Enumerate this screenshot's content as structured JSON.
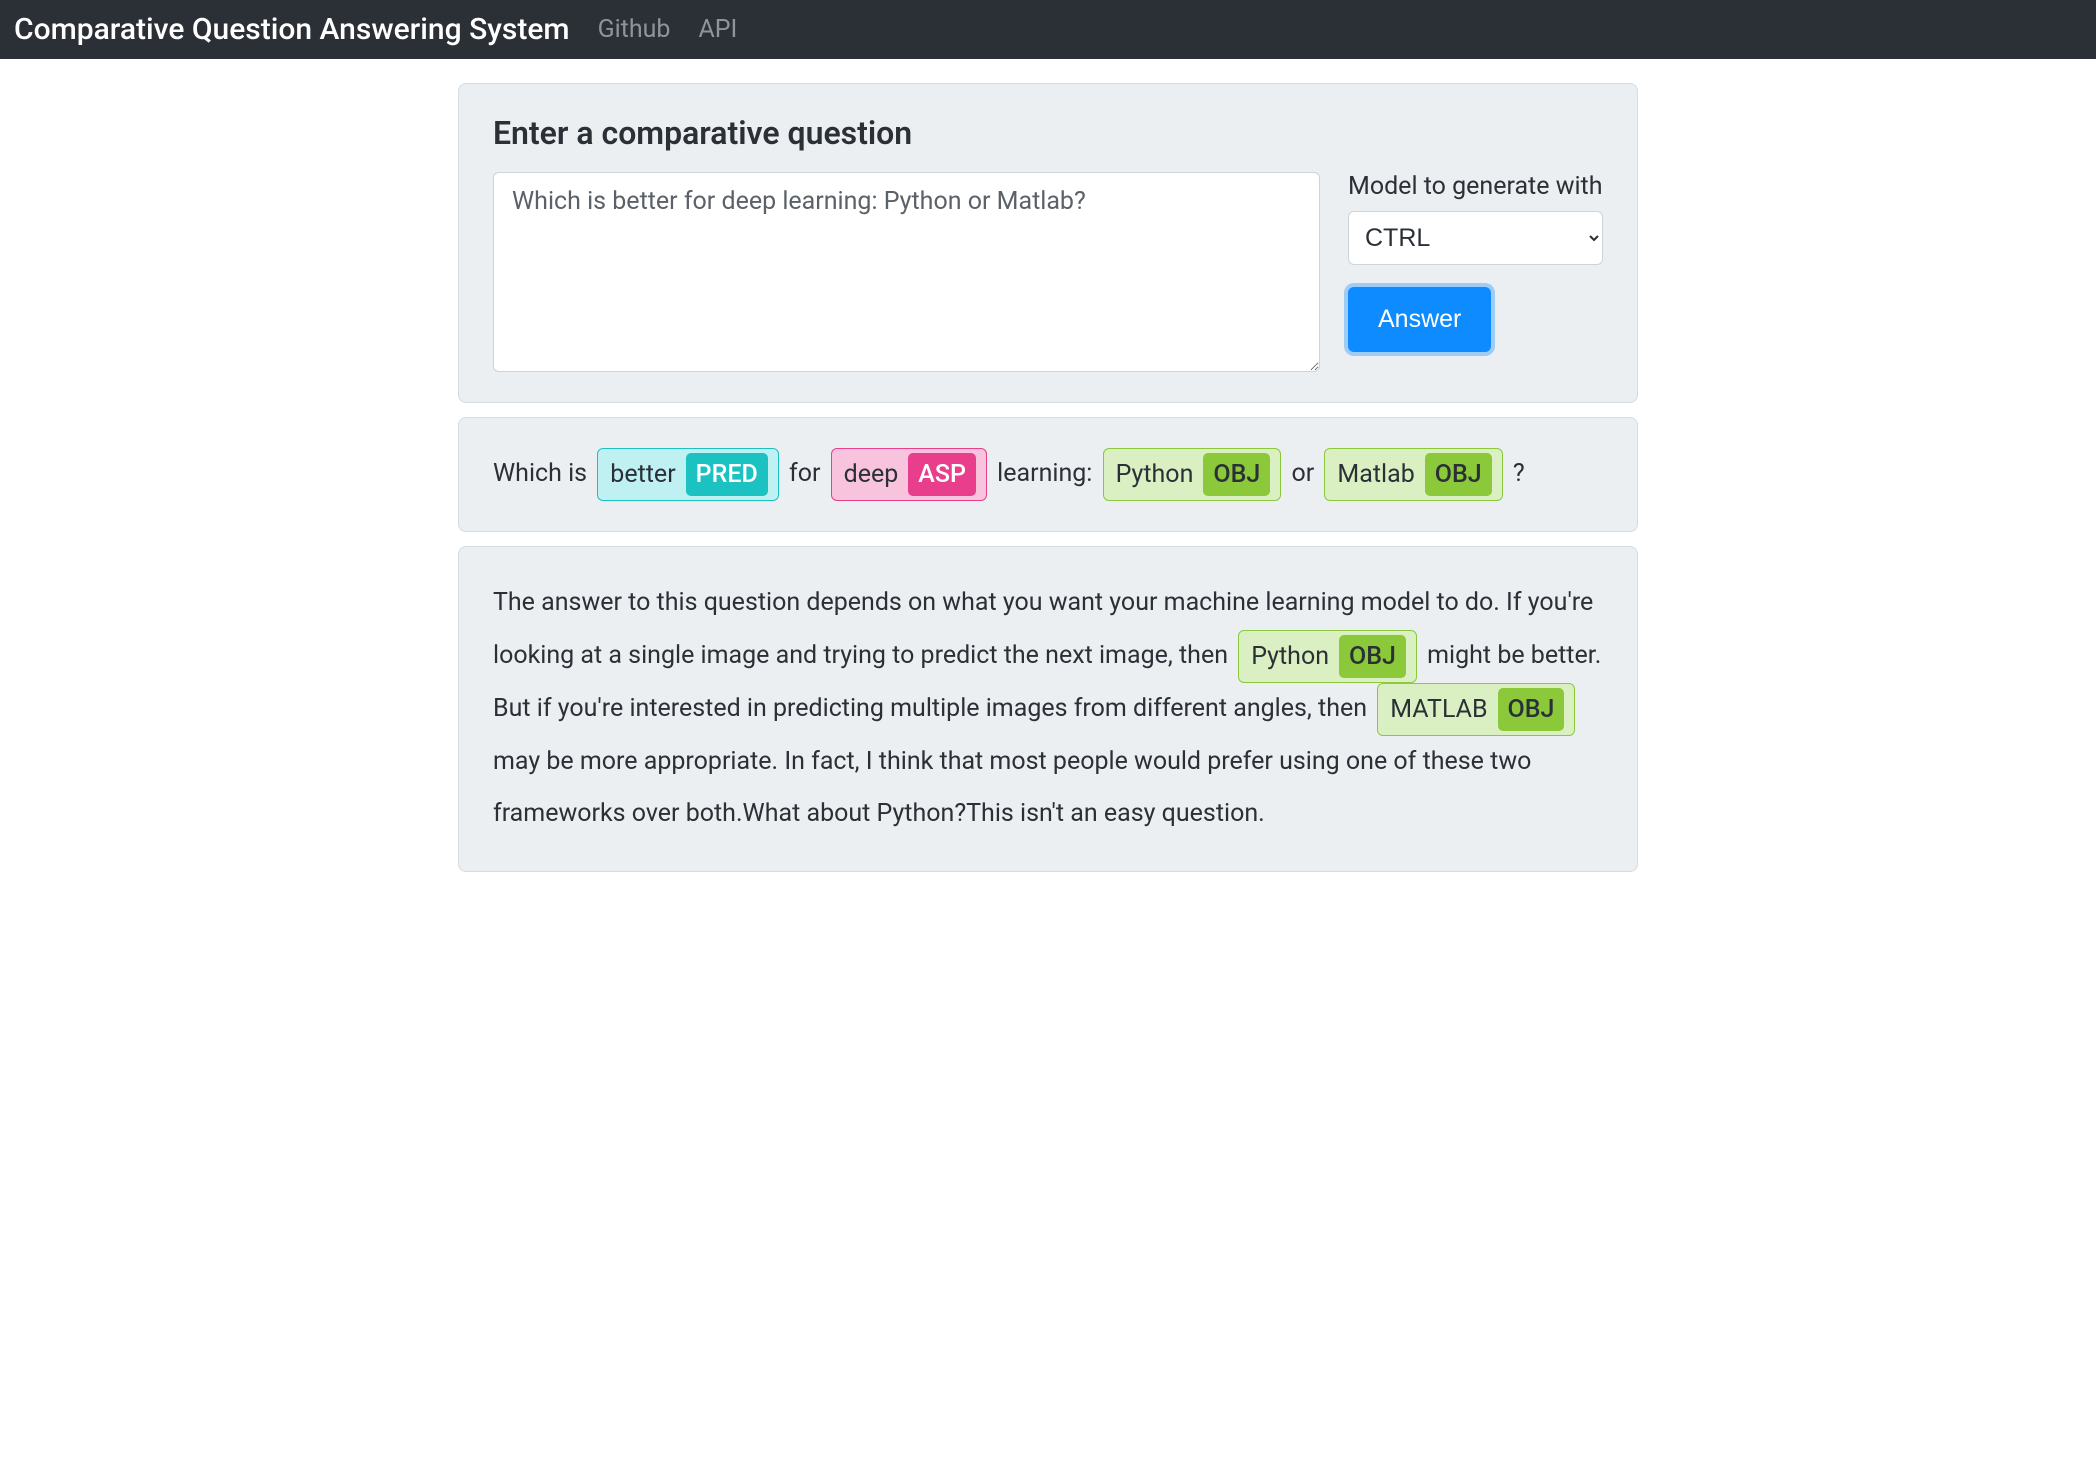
{
  "navbar": {
    "brand": "Comparative Question Answering System",
    "links": [
      "Github",
      "API"
    ]
  },
  "form": {
    "heading": "Enter a comparative question",
    "question_value": "Which is better for deep learning: Python or Matlab?",
    "model_label": "Model to generate with",
    "model_selected": "CTRL",
    "answer_button": "Answer"
  },
  "tags": {
    "PRED": "PRED",
    "ASP": "ASP",
    "OBJ": "OBJ"
  },
  "parsed": {
    "t0": "Which is ",
    "chip0_word": "better",
    "t1": " for ",
    "chip1_word": "deep",
    "t2": " learning: ",
    "chip2_word": "Python",
    "t3": " or ",
    "chip3_word": "Matlab",
    "t4": " ?"
  },
  "answer": {
    "s0": "The answer to this question depends on what you want your machine learning model to do. If you're looking at a single image and trying to predict the next image, then ",
    "chip0_word": "Python",
    "s1": " might be better. But if you're interested in predicting multiple images from different angles, then ",
    "chip1_word": "MATLAB",
    "s2": " may be more appropriate. In fact, I think that most people would prefer using one of these two frameworks over both.What about Python?This isn't an easy question."
  }
}
